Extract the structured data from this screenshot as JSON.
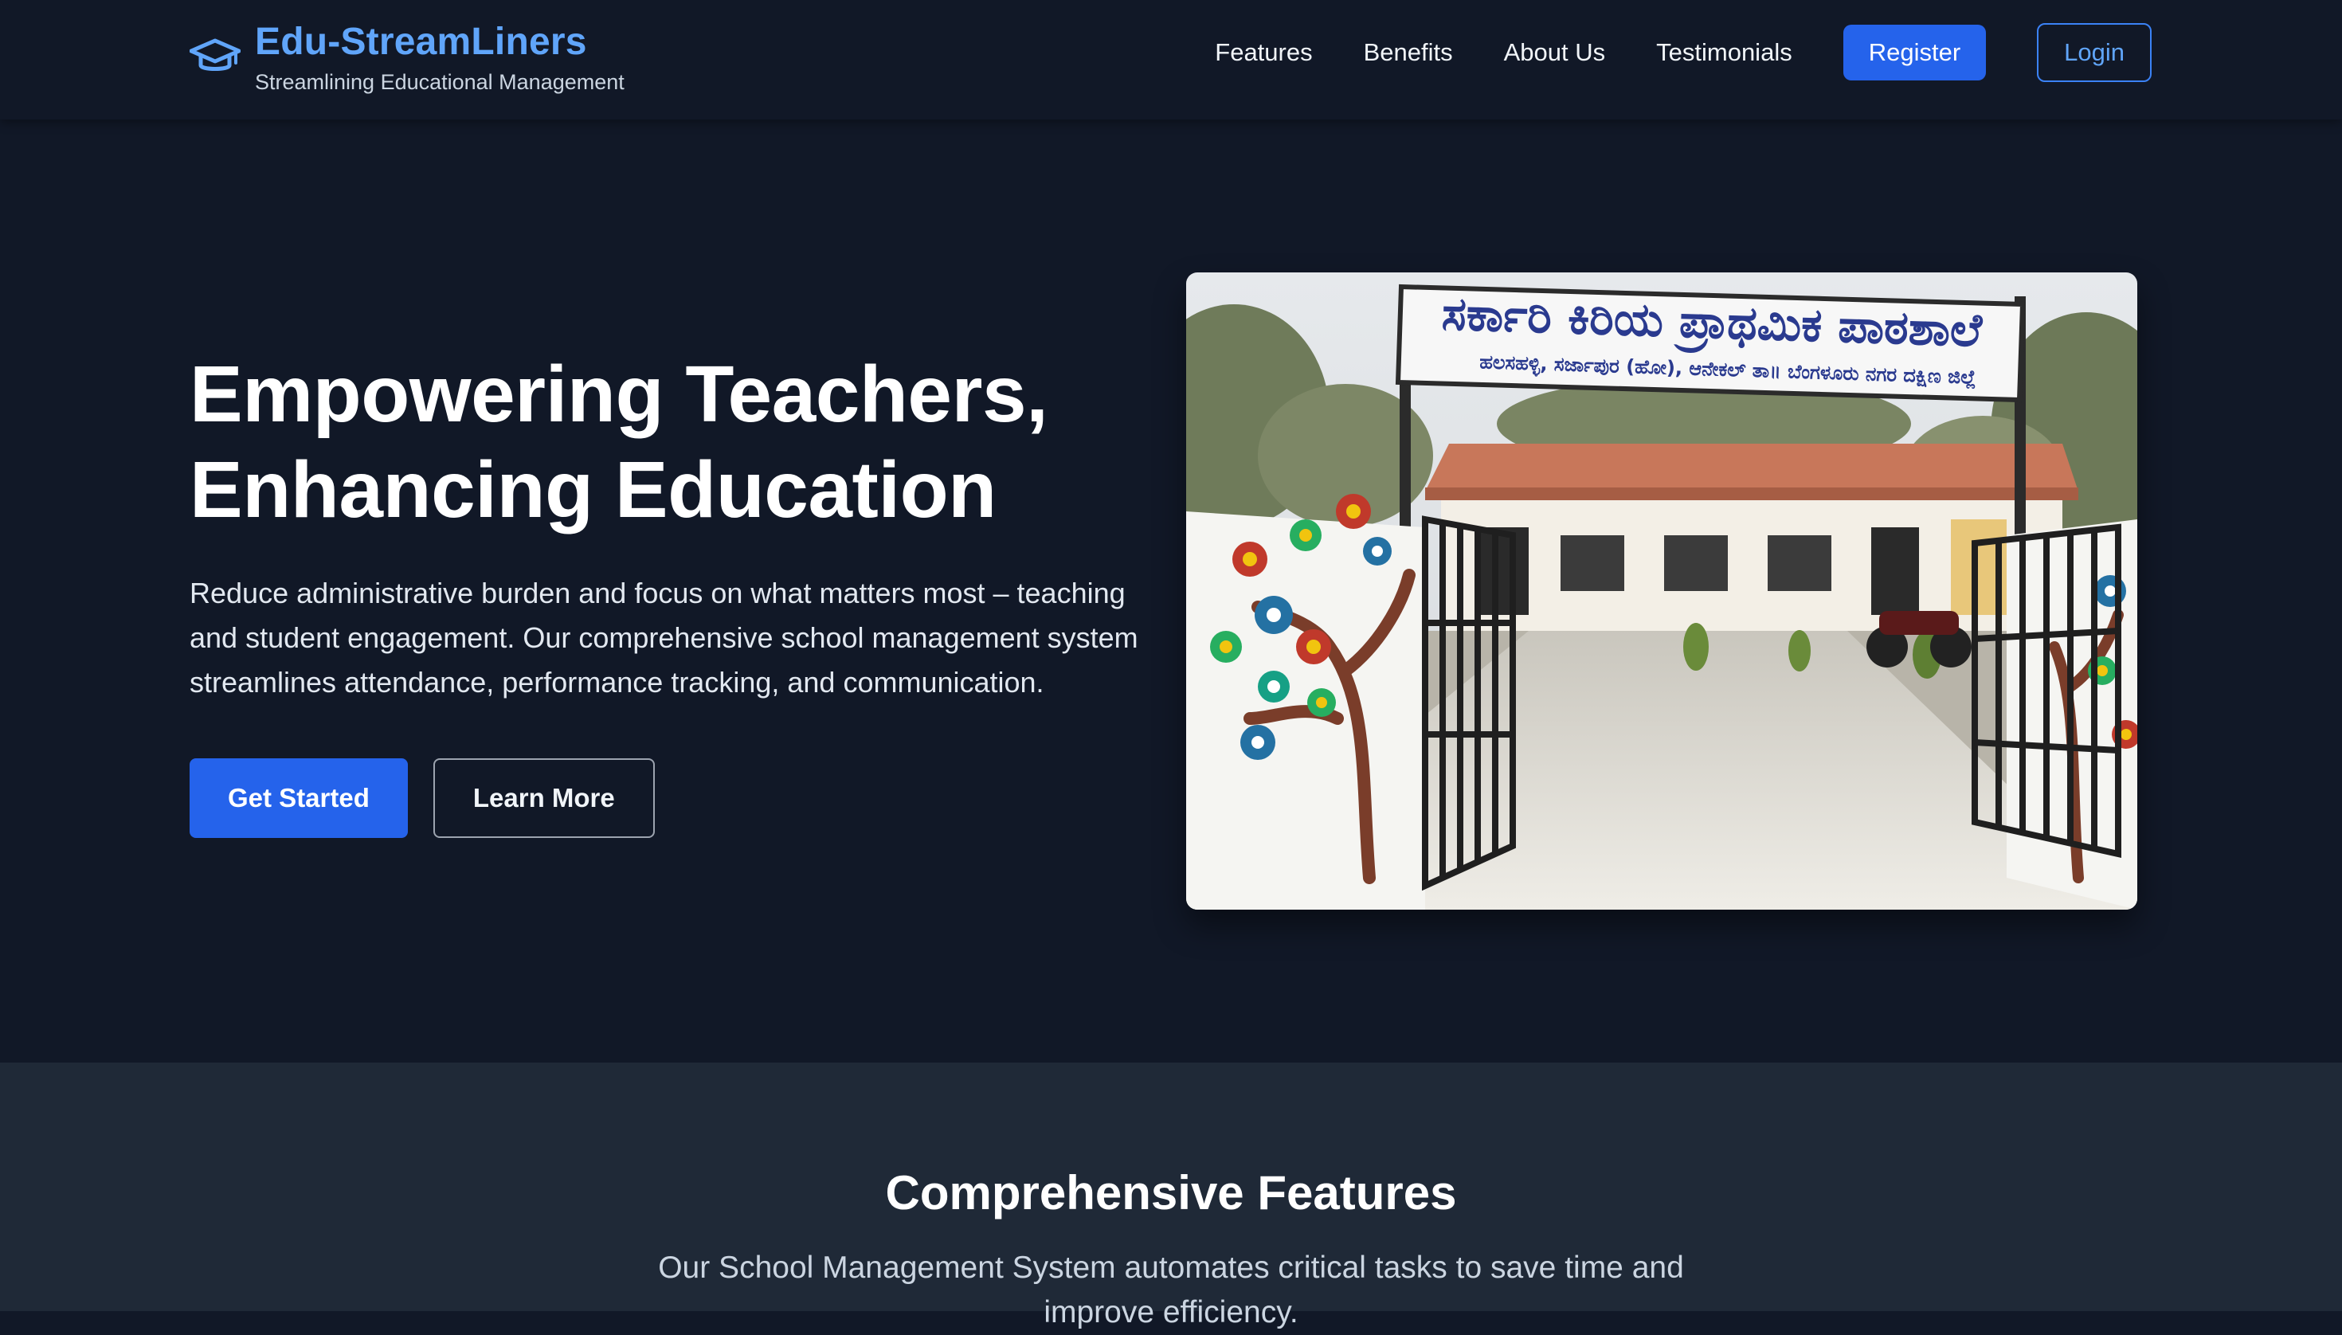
{
  "brand": {
    "title": "Edu-StreamLiners",
    "tagline": "Streamlining Educational Management",
    "icon": "graduation-cap-icon"
  },
  "nav": {
    "links": [
      "Features",
      "Benefits",
      "About Us",
      "Testimonials"
    ],
    "register_label": "Register",
    "login_label": "Login"
  },
  "hero": {
    "title_line1": "Empowering Teachers,",
    "title_line2": "Enhancing Education",
    "description": "Reduce administrative burden and focus on what matters most – teaching and student engagement. Our comprehensive school management system streamlines attendance, performance tracking, and communication.",
    "primary_cta": "Get Started",
    "secondary_cta": "Learn More",
    "image": {
      "sign_main": "ಸರ್ಕಾರಿ ಕಿರಿಯ ಪ್ರಾಥಮಿಕ ಪಾಠಶಾಲೆ",
      "sign_sub": "ಹಲಸಹಳ್ಳಿ, ಸರ್ಜಾಪುರ (ಹೋ), ಆನೇಕಲ್ ತಾ॥ ಬೆಂಗಳೂರು ನಗರ ದಕ್ಷಿಣ ಜಿಲ್ಲೆ"
    }
  },
  "features": {
    "title": "Comprehensive Features",
    "description": "Our School Management System automates critical tasks to save time and improve efficiency."
  },
  "colors": {
    "background": "#111827",
    "section_alt": "#1f2937",
    "accent": "#2563eb",
    "brand_blue": "#60a5fa"
  }
}
